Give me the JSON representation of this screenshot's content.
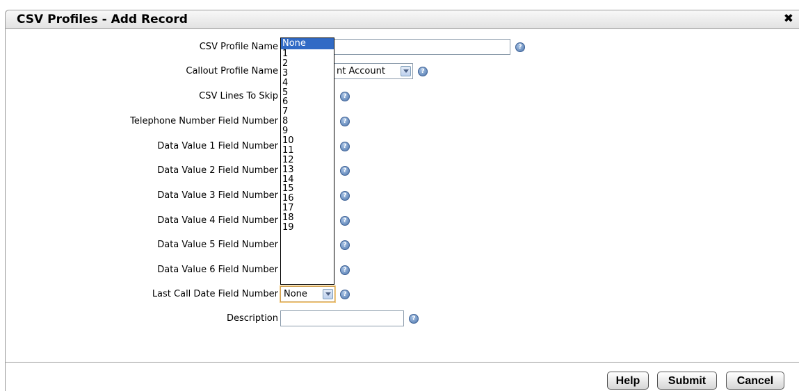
{
  "dialog": {
    "title": "CSV Profiles - Add Record",
    "close_glyph": "✖"
  },
  "form": {
    "csv_profile_name": {
      "label": "CSV Profile Name",
      "value": ""
    },
    "callout_profile_name": {
      "label": "Callout Profile Name",
      "selected": "nt Account"
    },
    "csv_lines_to_skip": {
      "label": "CSV Lines To Skip"
    },
    "telephone_number_field": {
      "label": "Telephone Number Field Number"
    },
    "data_value_1": {
      "label": "Data Value 1 Field Number"
    },
    "data_value_2": {
      "label": "Data Value 2 Field Number"
    },
    "data_value_3": {
      "label": "Data Value 3 Field Number"
    },
    "data_value_4": {
      "label": "Data Value 4 Field Number"
    },
    "data_value_5": {
      "label": "Data Value 5 Field Number"
    },
    "data_value_6": {
      "label": "Data Value 6 Field Number"
    },
    "last_call_date": {
      "label": "Last Call Date Field Number",
      "selected": "None"
    },
    "description": {
      "label": "Description",
      "value": ""
    }
  },
  "dropdown_options": [
    "None",
    "1",
    "2",
    "3",
    "4",
    "5",
    "6",
    "7",
    "8",
    "9",
    "10",
    "11",
    "12",
    "13",
    "14",
    "15",
    "16",
    "17",
    "18",
    "19"
  ],
  "buttons": {
    "help": "Help",
    "submit": "Submit",
    "cancel": "Cancel"
  },
  "icons": {
    "help": "help-icon",
    "close": "close-icon",
    "dropdown_arrow": "chevron-down-icon"
  }
}
